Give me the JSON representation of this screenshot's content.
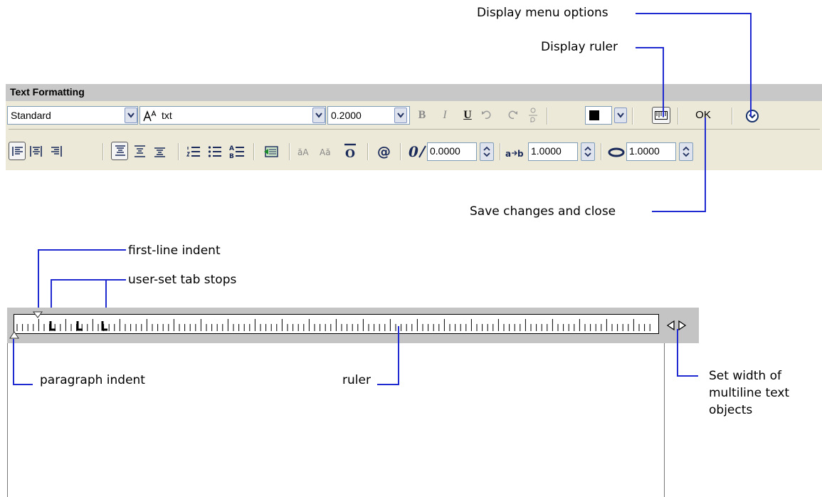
{
  "callouts": {
    "display_menu_options": "Display menu options",
    "display_ruler": "Display ruler",
    "save_changes": "Save changes and close",
    "first_line_indent": "first-line indent",
    "user_tab_stops": "user-set tab stops",
    "paragraph_indent": "paragraph indent",
    "ruler": "ruler",
    "set_width": [
      "Set width of",
      "multiline text",
      "objects"
    ]
  },
  "toolbar": {
    "title": "Text Formatting",
    "style_value": "Standard",
    "font_value": "txt",
    "height_value": "0.2000",
    "bold_label": "B",
    "italic_label": "I",
    "underline_label": "U",
    "ok_label": "OK",
    "oblique_value": "0.0000",
    "tracking_value": "1.0000",
    "width_factor_value": "1.0000",
    "color_swatch": "#000000"
  },
  "colors": {
    "callout_line": "#1f2bd0",
    "toolbar_bg": "#ece9d8",
    "title_bar": "#c8c8c8",
    "ruler_band": "#c4c4c4"
  }
}
